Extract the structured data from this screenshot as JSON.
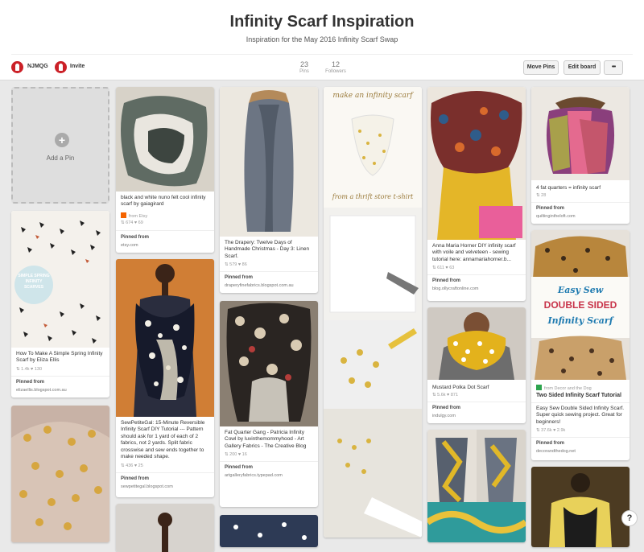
{
  "board": {
    "title": "Infinity Scarf Inspiration",
    "subtitle": "Inspiration for the May 2016 Infinity Scarf Swap"
  },
  "header": {
    "user_name": "NJMQG",
    "invite_label": "Invite",
    "pins_count": "23",
    "pins_label": "Pins",
    "followers_count": "12",
    "followers_label": "Followers",
    "move_pins_label": "Move Pins",
    "edit_board_label": "Edit board",
    "more_label": "•••"
  },
  "add_pin_label": "Add a Pin",
  "pinned_from_label": "Pinned from",
  "help_label": "?",
  "pins": [
    {
      "desc": "black and white nuno felt cool infinity scarf by gaiagirard",
      "badge": "from Etsy",
      "stats": "⇅ 674  ♥ 69",
      "source": "etsy.com"
    },
    {
      "desc": "The Drapery: Twelve Days of Handmade Christmas - Day 3: Linen Scarf.",
      "stats": "⇅ 579  ♥ 86",
      "source": "draperyfinefabrics.blogspot.com.au"
    },
    {
      "overlay_top": "make an infinity scarf",
      "overlay_bottom": "from a thrift store t-shirt"
    },
    {
      "desc": "Anna Maria Horner DIY infinity scarf with voile and velveteen - sewing tutorial here: annamariahorner.b...",
      "stats": "⇅ 611  ♥ 63",
      "source": "blog.ollycraftonline.com"
    },
    {
      "desc": "4 fat quarters = infinity scarf",
      "stats": "⇅ 28",
      "source": "quiltingintheloft.com"
    },
    {
      "desc": "How To Make A Simple Spring Infinity Scarf by Eliza Ellis",
      "stats": "⇅ 1.4k  ♥ 130",
      "source": "elizaellis.blogspot.com.au",
      "overlay": "SIMPLE SPRING INFINITY SCARVES"
    },
    {
      "desc": "SewPetiteGal: 15-Minute Reversible Infinity Scarf DIY Tutorial --- Pattern should ask for 1 yard of each of 2 fabrics, not 2 yards. Split fabric crosswise and sew ends together to make needed shape.",
      "stats": "⇅ 436  ♥ 25",
      "source": "sewpetitegal.blogspot.com"
    },
    {
      "desc": "Fat Quarter Gang - Patricia Infinity Cowl by luvinthemommyhood - Art Gallery Fabrics - The Creative Blog",
      "stats": "⇅ 200  ♥ 16",
      "source": "artgalleryfabrics.typepad.com"
    },
    {
      "desc": "Mustard Polka Dot Scarf",
      "stats": "⇅ 5.6k  ♥ 871",
      "source": "indulgy.com"
    },
    {
      "desc_bold": "Two Sided Infinity Scarf Tutorial",
      "desc": "Easy Sew Double Sided Infinity Scarf. Super quick sewing project. Great for beginners!",
      "badge": "from Decor and the Dog",
      "stats": "⇅ 37.6k  ♥ 2.9k",
      "source": "decorandthedog.net",
      "overlay1": "Easy Sew",
      "overlay2": "DOUBLE SIDED",
      "overlay3": "Infinity Scarf"
    }
  ],
  "colors": {
    "accent": "#cb2027",
    "background": "#e9e9e9",
    "card": "#ffffff"
  }
}
